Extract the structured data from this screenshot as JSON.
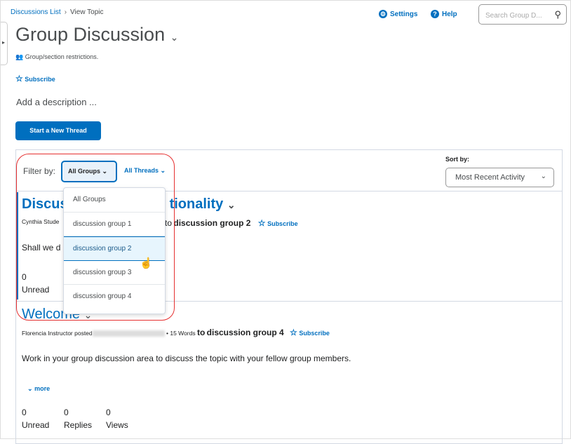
{
  "breadcrumb": {
    "link": "Discussions List",
    "separator": "›",
    "current": "View Topic"
  },
  "header": {
    "settings": "Settings",
    "help": "Help",
    "search_placeholder": "Search Group D..."
  },
  "page": {
    "title": "Group Discussion",
    "restrictions": "Group/section restrictions.",
    "subscribe": "Subscribe",
    "description": "Add a description ...",
    "new_thread": "Start a New Thread"
  },
  "filter": {
    "label": "Filter by:",
    "groups_value": "All Groups",
    "threads_value": "All Threads",
    "sort_label": "Sort by:",
    "sort_value": "Most Recent Activity",
    "group_options": [
      "All Groups",
      "discussion group 1",
      "discussion group 2",
      "discussion group 3",
      "discussion group 4"
    ],
    "highlighted_option": "discussion group 2"
  },
  "threads": [
    {
      "title_start": "Discus",
      "title_end": "tionality",
      "author": "Cynthia Stude",
      "to_text": "to",
      "group": "discussion group 2",
      "subscribe": "Subscribe",
      "body": "Shall we d",
      "unread": "0",
      "unread_label": "Unread"
    },
    {
      "title": "Welcome",
      "author": "Florencia Instructor posted",
      "words": "• 15 Words",
      "to_text": "to",
      "group": "discussion group 4",
      "subscribe": "Subscribe",
      "body": "Work in your group discussion area to discuss the topic with your fellow group members.",
      "more": "more",
      "stats": [
        {
          "value": "0",
          "label": "Unread"
        },
        {
          "value": "0",
          "label": "Replies"
        },
        {
          "value": "0",
          "label": "Views"
        }
      ]
    }
  ],
  "colors": {
    "accent": "#006fbf",
    "highlight": "#e53030"
  }
}
